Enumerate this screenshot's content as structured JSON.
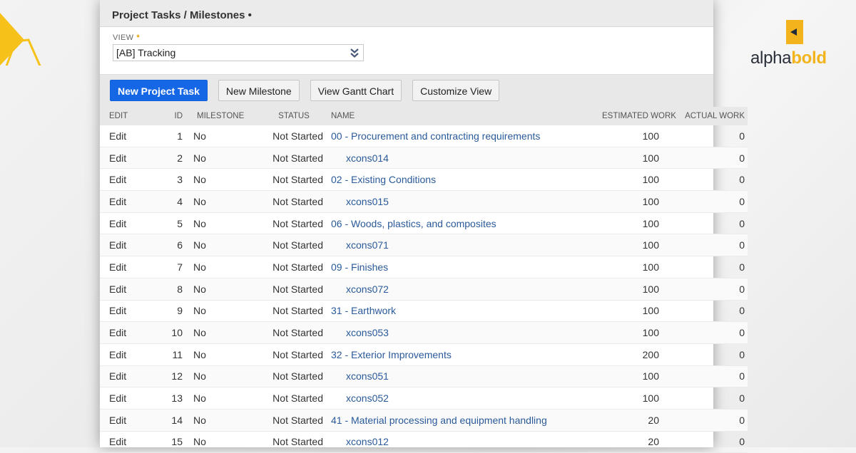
{
  "panel": {
    "title": "Project Tasks / Milestones •",
    "view_label": "VIEW",
    "view_required_marker": "*",
    "view_value": "[AB] Tracking"
  },
  "toolbar": {
    "new_project_task": "New Project Task",
    "new_milestone": "New Milestone",
    "view_gantt_chart": "View Gantt Chart",
    "customize_view": "Customize View"
  },
  "table": {
    "headers": {
      "edit": "EDIT",
      "id": "ID",
      "milestone": "MILESTONE",
      "status": "STATUS",
      "name": "NAME",
      "estimated_work": "ESTIMATED WORK",
      "actual_work": "ACTUAL WORK"
    },
    "rows": [
      {
        "edit": "Edit",
        "id": "1",
        "milestone": "No",
        "status": "Not Started",
        "name": "00 - Procurement and contracting requirements",
        "child": false,
        "estimated": "100",
        "actual": "0"
      },
      {
        "edit": "Edit",
        "id": "2",
        "milestone": "No",
        "status": "Not Started",
        "name": "xcons014",
        "child": true,
        "estimated": "100",
        "actual": "0"
      },
      {
        "edit": "Edit",
        "id": "3",
        "milestone": "No",
        "status": "Not Started",
        "name": "02 - Existing Conditions",
        "child": false,
        "estimated": "100",
        "actual": "0"
      },
      {
        "edit": "Edit",
        "id": "4",
        "milestone": "No",
        "status": "Not Started",
        "name": "xcons015",
        "child": true,
        "estimated": "100",
        "actual": "0"
      },
      {
        "edit": "Edit",
        "id": "5",
        "milestone": "No",
        "status": "Not Started",
        "name": "06 - Woods, plastics, and composites",
        "child": false,
        "estimated": "100",
        "actual": "0"
      },
      {
        "edit": "Edit",
        "id": "6",
        "milestone": "No",
        "status": "Not Started",
        "name": "xcons071",
        "child": true,
        "estimated": "100",
        "actual": "0"
      },
      {
        "edit": "Edit",
        "id": "7",
        "milestone": "No",
        "status": "Not Started",
        "name": "09 - Finishes",
        "child": false,
        "estimated": "100",
        "actual": "0"
      },
      {
        "edit": "Edit",
        "id": "8",
        "milestone": "No",
        "status": "Not Started",
        "name": "xcons072",
        "child": true,
        "estimated": "100",
        "actual": "0"
      },
      {
        "edit": "Edit",
        "id": "9",
        "milestone": "No",
        "status": "Not Started",
        "name": "31 - Earthwork",
        "child": false,
        "estimated": "100",
        "actual": "0"
      },
      {
        "edit": "Edit",
        "id": "10",
        "milestone": "No",
        "status": "Not Started",
        "name": "xcons053",
        "child": true,
        "estimated": "100",
        "actual": "0"
      },
      {
        "edit": "Edit",
        "id": "11",
        "milestone": "No",
        "status": "Not Started",
        "name": "32 - Exterior Improvements",
        "child": false,
        "estimated": "200",
        "actual": "0"
      },
      {
        "edit": "Edit",
        "id": "12",
        "milestone": "No",
        "status": "Not Started",
        "name": "xcons051",
        "child": true,
        "estimated": "100",
        "actual": "0"
      },
      {
        "edit": "Edit",
        "id": "13",
        "milestone": "No",
        "status": "Not Started",
        "name": "xcons052",
        "child": true,
        "estimated": "100",
        "actual": "0"
      },
      {
        "edit": "Edit",
        "id": "14",
        "milestone": "No",
        "status": "Not Started",
        "name": "41 - Material processing and equipment handling",
        "child": false,
        "estimated": "20",
        "actual": "0"
      },
      {
        "edit": "Edit",
        "id": "15",
        "milestone": "No",
        "status": "Not Started",
        "name": "xcons012",
        "child": true,
        "estimated": "20",
        "actual": "0"
      }
    ]
  },
  "brand": {
    "name_part1": "alpha",
    "name_part2": "bold",
    "accent_color": "#f2b31c",
    "icon": "alphabold-logo-icon"
  },
  "colors": {
    "primary_button": "#1667e6",
    "link": "#2a5a9a",
    "triangle_logo": "#f6c21a"
  }
}
